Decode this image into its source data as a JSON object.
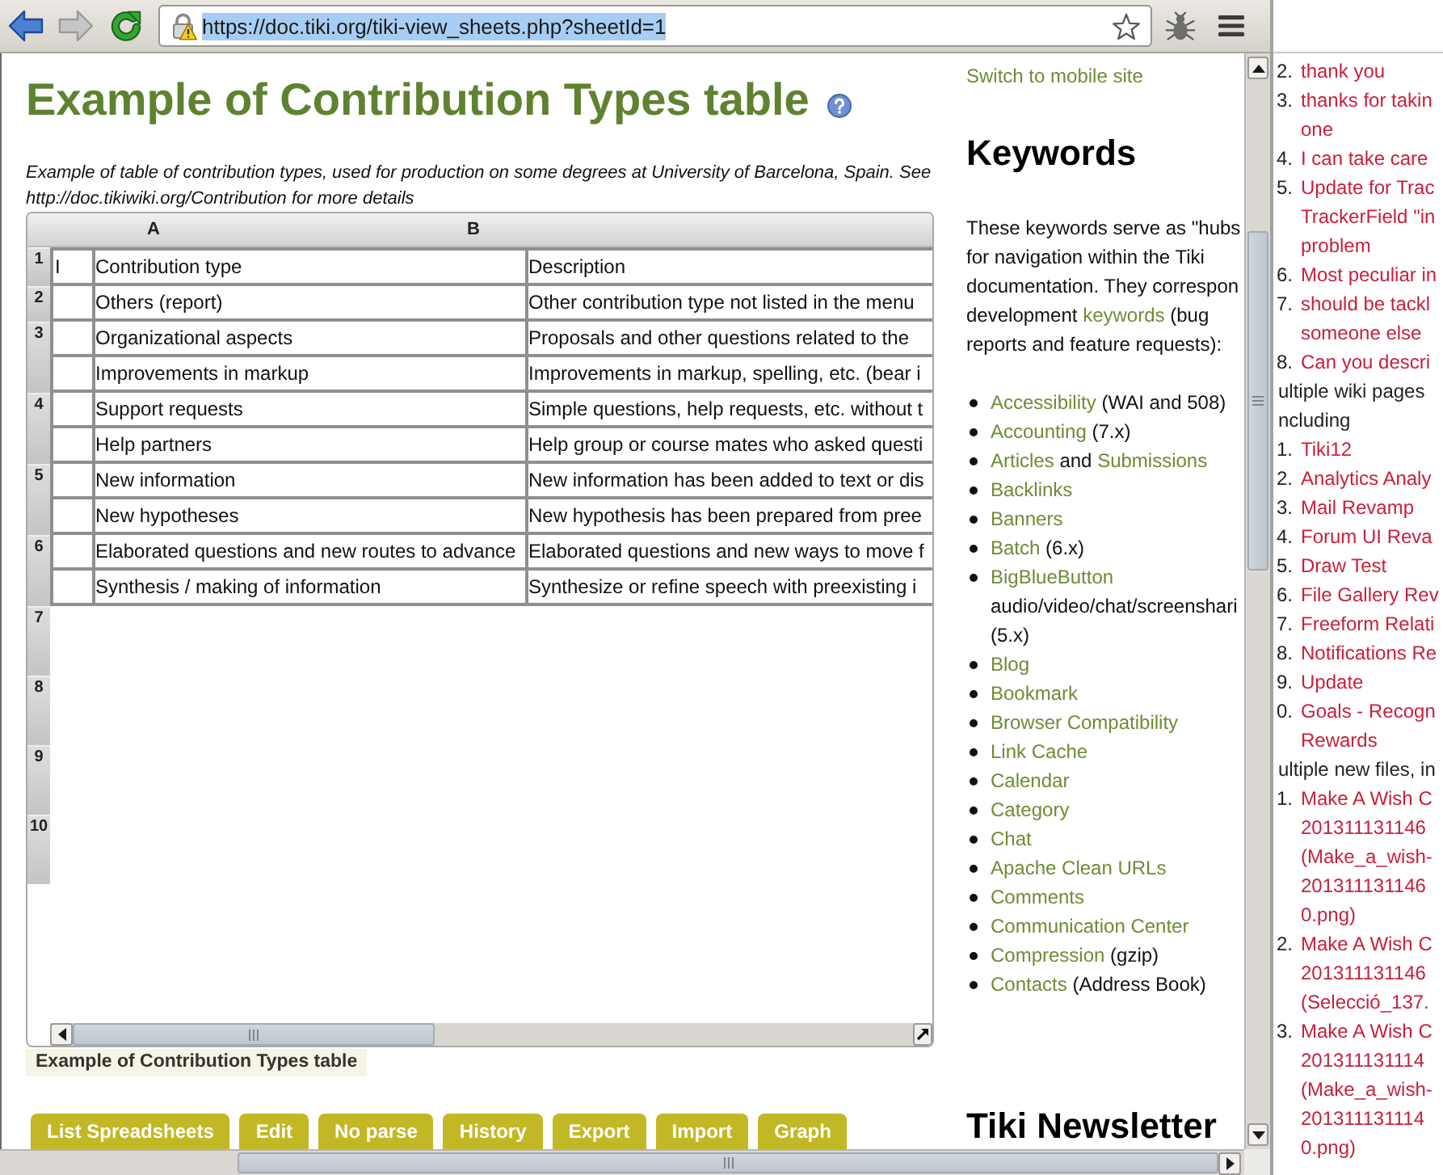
{
  "toolbar": {
    "navigation": [
      {
        "kind": "back",
        "disabled": false
      },
      {
        "kind": "forward",
        "disabled": true
      },
      {
        "kind": "reload",
        "disabled": false
      }
    ],
    "address_bar": {
      "url": "https://doc.tiki.org/tiki-view_sheets.php?sheetId=1",
      "selected": true,
      "bookmarked": false
    }
  },
  "page": {
    "title": "Example of Contribution Types table",
    "description": "Example of table of contribution types, used for production on some degrees at University of Barcelona, Spain. See http://doc.tikiwiki.org/Contribution for more details",
    "sheet": {
      "column_headers": [
        "A",
        "B"
      ],
      "rows": [
        {
          "number": "1",
          "lines": [
            {
              "column_1": "I",
              "column_2": "Contribution type",
              "column_3": "Description"
            }
          ]
        },
        {
          "number": "2",
          "lines": [
            {
              "column_2": "Others (report)",
              "column_3": "Other contribution type not listed in the menu"
            }
          ]
        },
        {
          "number": "3",
          "lines": [
            {
              "column_2": "Organizational aspects",
              "column_3": "Proposals and other questions related to the"
            },
            {
              "column_2": "Improvements in markup",
              "column_3": "Improvements in markup, spelling, etc. (bear i"
            }
          ]
        },
        {
          "number": "4",
          "lines": [
            {
              "column_2": "Support requests",
              "column_3": "Simple questions, help requests, etc. without t"
            },
            {
              "column_2": "Help partners",
              "column_3": "Help group or course mates who asked questi"
            }
          ]
        },
        {
          "number": "5",
          "lines": [
            {
              "column_2": "New information",
              "column_3": "New information has been added to text or dis"
            },
            {
              "column_2": "New hypotheses",
              "column_3": "New hypothesis has been prepared from pree"
            }
          ]
        },
        {
          "number": "6",
          "lines": [
            {
              "column_2": "Elaborated questions and new routes to advance",
              "column_3": "Elaborated questions and new ways to move f"
            },
            {
              "column_2": "Synthesis / making of information",
              "column_3": "Synthesize or refine speech with preexisting i"
            }
          ]
        },
        {
          "number": "7"
        },
        {
          "number": "8"
        },
        {
          "number": "9"
        },
        {
          "number": "10"
        }
      ],
      "caption": "Example of Contribution Types table"
    },
    "actions": [
      "List Spreadsheets",
      "Edit",
      "No parse",
      "History",
      "Export",
      "Import",
      "Graph"
    ]
  },
  "sidebar": {
    "mobile_link": "Switch to mobile site",
    "heading": "Keywords",
    "intro": [
      {
        "kind": "line",
        "text": "These keywords serve as \"hubs"
      },
      {
        "kind": "line",
        "text": "for navigation within the Tiki"
      },
      {
        "kind": "line",
        "text": "documentation. They correspon"
      },
      {
        "kind": "line",
        "text": "development"
      },
      {
        "kind": "link",
        "text": "keywords"
      },
      {
        "kind": "text",
        "text": "(bug"
      },
      {
        "kind": "line",
        "text": "reports and feature requests):"
      }
    ],
    "keywords": [
      {
        "parts": [
          {
            "kind": "link",
            "text": "Accessibility"
          },
          {
            "kind": "text",
            "text": "(WAI and 508)"
          }
        ]
      },
      {
        "parts": [
          {
            "kind": "link",
            "text": "Accounting"
          },
          {
            "kind": "text",
            "text": "(7.x)"
          }
        ]
      },
      {
        "parts": [
          {
            "kind": "link",
            "text": "Articles"
          },
          {
            "kind": "text",
            "text": "and"
          },
          {
            "kind": "link",
            "text": "Submissions"
          }
        ]
      },
      {
        "parts": [
          {
            "kind": "link",
            "text": "Backlinks"
          }
        ]
      },
      {
        "parts": [
          {
            "kind": "link",
            "text": "Banners"
          }
        ]
      },
      {
        "parts": [
          {
            "kind": "link",
            "text": "Batch"
          },
          {
            "kind": "text",
            "text": "(6.x)"
          }
        ]
      },
      {
        "parts": [
          {
            "kind": "link",
            "text": "BigBlueButton"
          },
          {
            "kind": "line",
            "text": "audio/video/chat/screenshari"
          },
          {
            "kind": "line",
            "text": "(5.x)"
          }
        ]
      },
      {
        "parts": [
          {
            "kind": "link",
            "text": "Blog"
          }
        ]
      },
      {
        "parts": [
          {
            "kind": "link",
            "text": "Bookmark"
          }
        ]
      },
      {
        "parts": [
          {
            "kind": "link",
            "text": "Browser Compatibility"
          }
        ]
      },
      {
        "parts": [
          {
            "kind": "link",
            "text": "Link Cache"
          }
        ]
      },
      {
        "parts": [
          {
            "kind": "link",
            "text": "Calendar"
          }
        ]
      },
      {
        "parts": [
          {
            "kind": "link",
            "text": "Category"
          }
        ]
      },
      {
        "parts": [
          {
            "kind": "link",
            "text": "Chat"
          }
        ]
      },
      {
        "parts": [
          {
            "kind": "link",
            "text": "Apache Clean URLs"
          }
        ]
      },
      {
        "parts": [
          {
            "kind": "link",
            "text": "Comments"
          }
        ]
      },
      {
        "parts": [
          {
            "kind": "link",
            "text": "Communication Center"
          }
        ]
      },
      {
        "parts": [
          {
            "kind": "link",
            "text": "Compression"
          },
          {
            "kind": "text",
            "text": "(gzip)"
          }
        ]
      },
      {
        "parts": [
          {
            "kind": "link",
            "text": "Contacts"
          },
          {
            "kind": "text",
            "text": "(Address Book)"
          }
        ]
      }
    ],
    "next_heading": "Tiki Newsletter"
  },
  "side_pane": {
    "entries": [
      {
        "kind": "item",
        "number": "2.",
        "lines": [
          "thank you"
        ]
      },
      {
        "kind": "item",
        "number": "3.",
        "lines": [
          "thanks for takin",
          "one"
        ]
      },
      {
        "kind": "item",
        "number": "4.",
        "lines": [
          "I can take care"
        ]
      },
      {
        "kind": "item",
        "number": "5.",
        "lines": [
          "Update for Trac",
          "TrackerField \"in",
          "problem"
        ]
      },
      {
        "kind": "item",
        "number": "6.",
        "lines": [
          "Most peculiar in"
        ]
      },
      {
        "kind": "item",
        "number": "7.",
        "lines": [
          "should be tackl",
          "someone else"
        ]
      },
      {
        "kind": "item",
        "number": "8.",
        "lines": [
          "Can you descri"
        ]
      },
      {
        "kind": "note",
        "lines": [
          "ultiple wiki pages",
          "ncluding"
        ]
      },
      {
        "kind": "item",
        "number": "1.",
        "lines": [
          "Tiki12"
        ]
      },
      {
        "kind": "item",
        "number": "2.",
        "lines": [
          "Analytics Analy"
        ]
      },
      {
        "kind": "item",
        "number": "3.",
        "lines": [
          "Mail Revamp"
        ]
      },
      {
        "kind": "item",
        "number": "4.",
        "lines": [
          "Forum UI Reva"
        ]
      },
      {
        "kind": "item",
        "number": "5.",
        "lines": [
          "Draw Test"
        ]
      },
      {
        "kind": "item",
        "number": "6.",
        "lines": [
          "File Gallery Rev"
        ]
      },
      {
        "kind": "item",
        "number": "7.",
        "lines": [
          "Freeform Relati"
        ]
      },
      {
        "kind": "item",
        "number": "8.",
        "lines": [
          "Notifications Re"
        ]
      },
      {
        "kind": "item",
        "number": "9.",
        "lines": [
          "Update"
        ]
      },
      {
        "kind": "item",
        "number": "0.",
        "lines": [
          "Goals - Recogn",
          "Rewards"
        ]
      },
      {
        "kind": "note",
        "lines": [
          "ultiple new files, in"
        ]
      },
      {
        "kind": "item",
        "number": "1.",
        "lines": [
          "Make A Wish C",
          "201311131146",
          "(Make_a_wish-",
          "201311131146",
          "0.png)"
        ]
      },
      {
        "kind": "item",
        "number": "2.",
        "lines": [
          "Make A Wish C",
          "201311131146",
          "(Selecció_137."
        ]
      },
      {
        "kind": "item",
        "number": "3.",
        "lines": [
          "Make A Wish C",
          "201311131114",
          "(Make_a_wish-",
          "201311131114",
          "0.png)"
        ]
      }
    ]
  }
}
